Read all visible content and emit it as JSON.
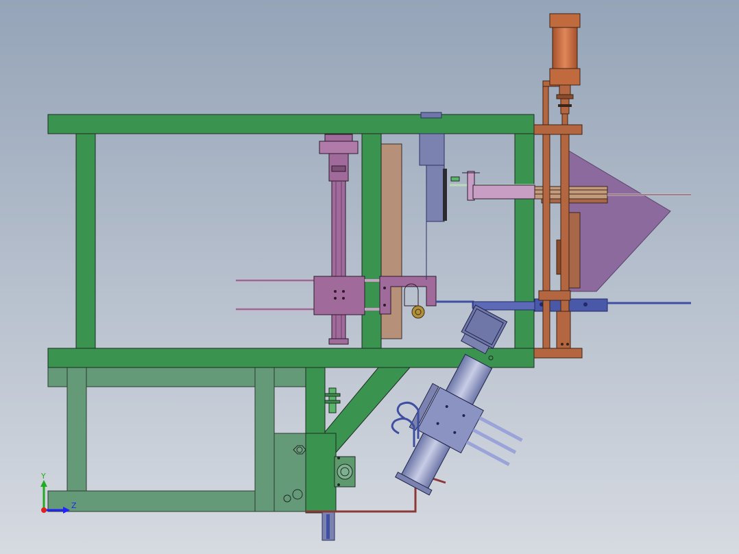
{
  "colors": {
    "bg_top": "#95a4b8",
    "bg_bottom": "#d6dae1",
    "frame_green": "#3a9450",
    "frame_green_light": "#659a79",
    "copper": "#b3663f",
    "copper_dark": "#8c4c2c",
    "magenta": "#a06a9a",
    "violet": "#8a6a9c",
    "steel_blue": "#7b82b0",
    "navy": "#3e4ea0",
    "tan": "#b69079",
    "olive_green": "#5e9a6e",
    "axis_x": "#2222ff",
    "axis_y": "#22aa22",
    "axis_origin": "#dd2222"
  },
  "triad": {
    "y_label": "Y",
    "x_label": "Z"
  }
}
